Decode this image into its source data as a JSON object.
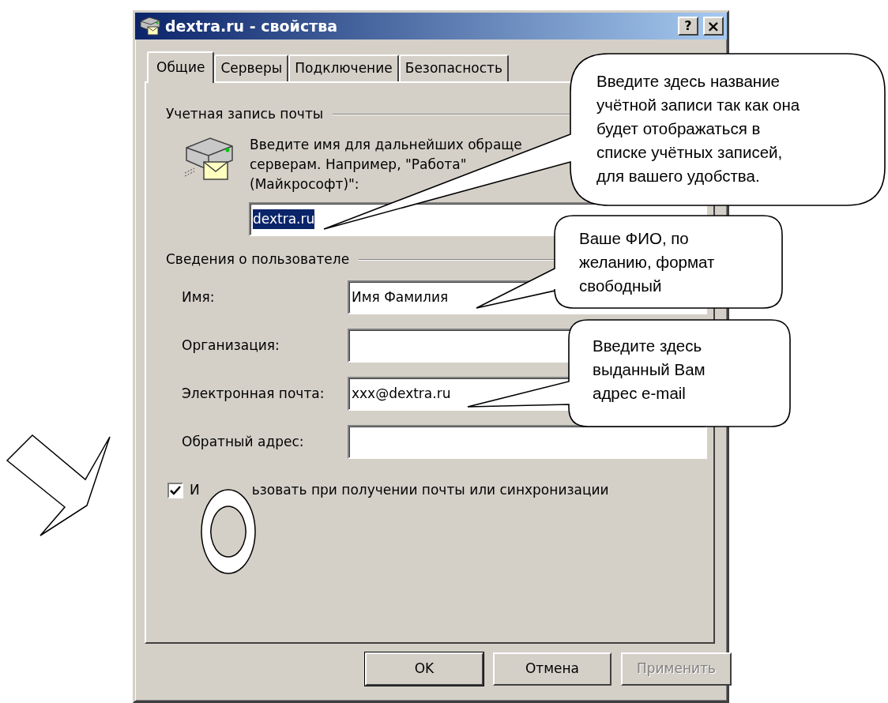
{
  "window": {
    "title": "dextra.ru - свойства",
    "buttons": [
      {
        "kind": "help",
        "label": "?"
      },
      {
        "kind": "close",
        "label": "×"
      }
    ]
  },
  "tabs": [
    {
      "label": "Общие",
      "selected": true
    },
    {
      "label": "Серверы",
      "selected": false
    },
    {
      "label": "Подключение",
      "selected": false
    },
    {
      "label": "Безопасность",
      "selected": false
    }
  ],
  "account_group": {
    "title": "Учетная запись почты",
    "description": [
      "Введите имя для дальнейших обраще",
      "серверам. Например, \"Работа\"",
      "(Майкрософт)\":"
    ],
    "field": {
      "value": "dextra.ru",
      "text_selected": true
    }
  },
  "user_group": {
    "title": "Сведения о пользователе",
    "fields": [
      {
        "label": "Имя:",
        "value": "Имя Фамилия"
      },
      {
        "label": "Организация:"
      },
      {
        "label": "Электронная почта:",
        "value": "xxx@dextra.ru"
      },
      {
        "label": "Обратный адрес:"
      }
    ]
  },
  "checkbox": {
    "label_parts": [
      "И",
      "ьзовать при получении почты или синхронизации"
    ],
    "checked": true
  },
  "buttons": [
    {
      "label": "OK",
      "default": true,
      "disabled": false
    },
    {
      "label": "Отмена",
      "default": false,
      "disabled": false
    },
    {
      "label": "Применить",
      "default": false,
      "disabled": true
    }
  ],
  "callouts": [
    {
      "lines": [
        "Введите здесь название",
        "учётной записи так как она",
        "будет отображаться в",
        "списке учётных записей,",
        "для вашего удобства."
      ]
    },
    {
      "lines": [
        "Ваше ФИО, по",
        "желанию, формат",
        "свободный"
      ]
    },
    {
      "lines": [
        "Введите здесь",
        "выданный Вам",
        "адрес e-mail"
      ]
    }
  ]
}
